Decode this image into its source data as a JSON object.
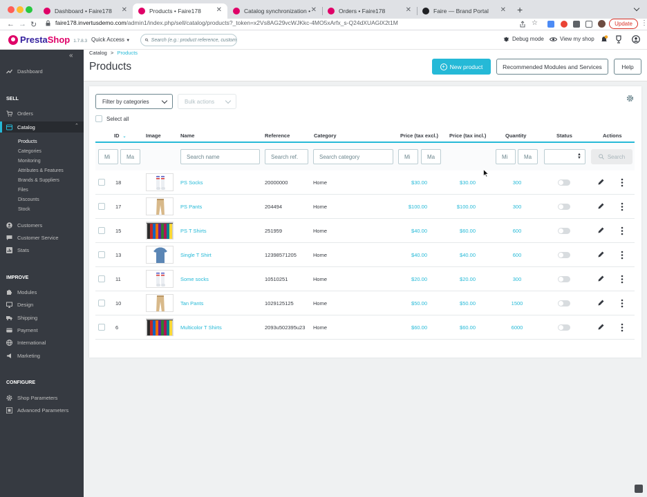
{
  "browser": {
    "tabs": [
      {
        "title": "Dashboard • Faire178"
      },
      {
        "title": "Products • Faire178"
      },
      {
        "title": "Catalog synchronization • Faire"
      },
      {
        "title": "Orders • Faire178"
      },
      {
        "title": "Faire — Brand Portal"
      }
    ],
    "url_host": "faire178.invertusdemo.com",
    "url_path": "/admin1/index.php/sell/catalog/products?_token=x2Vs8AG29vcWJKkc-4MO5xArfx_s-Q24dXUAGlX2t1M",
    "update_label": "Update"
  },
  "header": {
    "logo_part1": "Presta",
    "logo_part2": "Shop",
    "version": "1.7.8.3",
    "quick_access": "Quick Access",
    "search_placeholder": "Search (e.g.: product reference, custom",
    "debug_mode": "Debug mode",
    "view_shop": "View my shop"
  },
  "sidebar": {
    "dashboard": "Dashboard",
    "sell_heading": "SELL",
    "orders": "Orders",
    "catalog": "Catalog",
    "catalog_sub": [
      "Products",
      "Categories",
      "Monitoring",
      "Attributes & Features",
      "Brands & Suppliers",
      "Files",
      "Discounts",
      "Stock"
    ],
    "customers": "Customers",
    "customer_service": "Customer Service",
    "stats": "Stats",
    "improve_heading": "IMPROVE",
    "modules": "Modules",
    "design": "Design",
    "shipping": "Shipping",
    "payment": "Payment",
    "international": "International",
    "marketing": "Marketing",
    "configure_heading": "CONFIGURE",
    "shop_parameters": "Shop Parameters",
    "advanced_parameters": "Advanced Parameters"
  },
  "page": {
    "breadcrumb_parent": "Catalog",
    "breadcrumb_sep": ">",
    "breadcrumb_current": "Products",
    "title": "Products",
    "new_product": "New product",
    "recommended": "Recommended Modules and Services",
    "help": "Help"
  },
  "table": {
    "filter_categories": "Filter by categories",
    "bulk_actions": "Bulk actions",
    "select_all": "Select all",
    "columns": {
      "id": "ID",
      "image": "Image",
      "name": "Name",
      "reference": "Reference",
      "category": "Category",
      "price_excl": "Price (tax excl.)",
      "price_incl": "Price (tax incl.)",
      "quantity": "Quantity",
      "status": "Status",
      "actions": "Actions"
    },
    "filters": {
      "id_min": "Mi",
      "id_max": "Ma",
      "name": "Search name",
      "reference": "Search ref.",
      "category": "Search category",
      "price_min": "Mi",
      "price_max": "Ma",
      "qty_min": "Mi",
      "qty_max": "Ma",
      "search_button": "Search"
    },
    "rows": [
      {
        "id": "18",
        "image": "socks",
        "name": "PS Socks",
        "reference": "20000000",
        "category": "Home",
        "price_excl": "$30.00",
        "price_incl": "$30.00",
        "quantity": "300",
        "status": "disabled"
      },
      {
        "id": "17",
        "image": "pants",
        "name": "PS Pants",
        "reference": "204494",
        "category": "Home",
        "price_excl": "$100.00",
        "price_incl": "$100.00",
        "quantity": "300",
        "status": "disabled"
      },
      {
        "id": "15",
        "image": "tshirts-rack",
        "name": "PS T Shirts",
        "reference": "251959",
        "category": "Home",
        "price_excl": "$40.00",
        "price_incl": "$60.00",
        "quantity": "600",
        "status": "disabled"
      },
      {
        "id": "13",
        "image": "tshirt-single",
        "name": "Single T Shirt",
        "reference": "12398571205",
        "category": "Home",
        "price_excl": "$40.00",
        "price_incl": "$40.00",
        "quantity": "600",
        "status": "disabled"
      },
      {
        "id": "11",
        "image": "socks",
        "name": "Some socks",
        "reference": "10510251",
        "category": "Home",
        "price_excl": "$20.00",
        "price_incl": "$20.00",
        "quantity": "300",
        "status": "disabled"
      },
      {
        "id": "10",
        "image": "pants",
        "name": "Tan Pants",
        "reference": "1029125125",
        "category": "Home",
        "price_excl": "$50.00",
        "price_incl": "$50.00",
        "quantity": "1500",
        "status": "disabled"
      },
      {
        "id": "6",
        "image": "tshirts-rack",
        "name": "Multicolor T Shirts",
        "reference": "2093u502395u23",
        "category": "Home",
        "price_excl": "$60.00",
        "price_incl": "$60.00",
        "quantity": "6000",
        "status": "disabled"
      }
    ]
  },
  "colors": {
    "accent": "#25b9d7",
    "brand_pink": "#df0067",
    "sidebar_bg": "#363a41"
  }
}
